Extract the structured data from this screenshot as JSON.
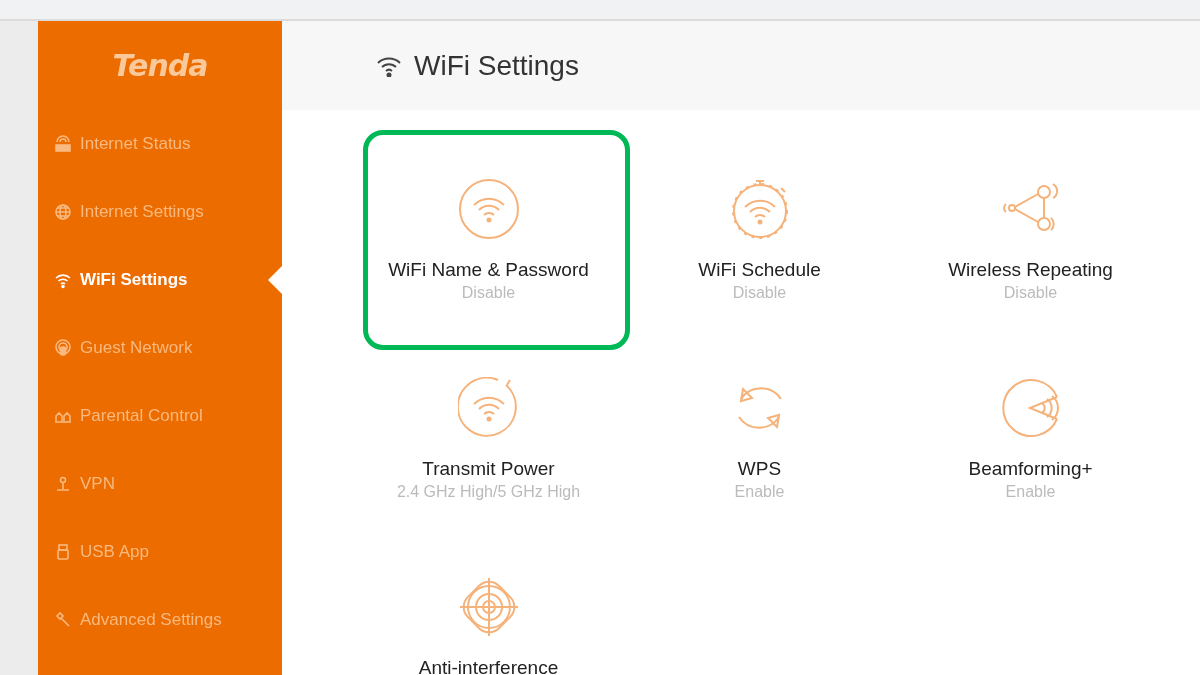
{
  "sidebar": {
    "logo": "Tenda",
    "items": [
      {
        "label": "Internet Status",
        "selected": false
      },
      {
        "label": "Internet Settings",
        "selected": false
      },
      {
        "label": "WiFi Settings",
        "selected": true
      },
      {
        "label": "Guest Network",
        "selected": false
      },
      {
        "label": "Parental Control",
        "selected": false
      },
      {
        "label": "VPN",
        "selected": false
      },
      {
        "label": "USB App",
        "selected": false
      },
      {
        "label": "Advanced Settings",
        "selected": false
      }
    ]
  },
  "header": {
    "title": "WiFi Settings"
  },
  "tiles": [
    {
      "title": "WiFi Name & Password",
      "status": "Disable",
      "highlighted": true
    },
    {
      "title": "WiFi Schedule",
      "status": "Disable",
      "highlighted": false
    },
    {
      "title": "Wireless Repeating",
      "status": "Disable",
      "highlighted": false
    },
    {
      "title": "Transmit Power",
      "status": "2.4 GHz High/5 GHz High",
      "highlighted": false
    },
    {
      "title": "WPS",
      "status": "Enable",
      "highlighted": false
    },
    {
      "title": "Beamforming+",
      "status": "Enable",
      "highlighted": false
    },
    {
      "title": "Anti-interference",
      "highlighted": false
    }
  ]
}
